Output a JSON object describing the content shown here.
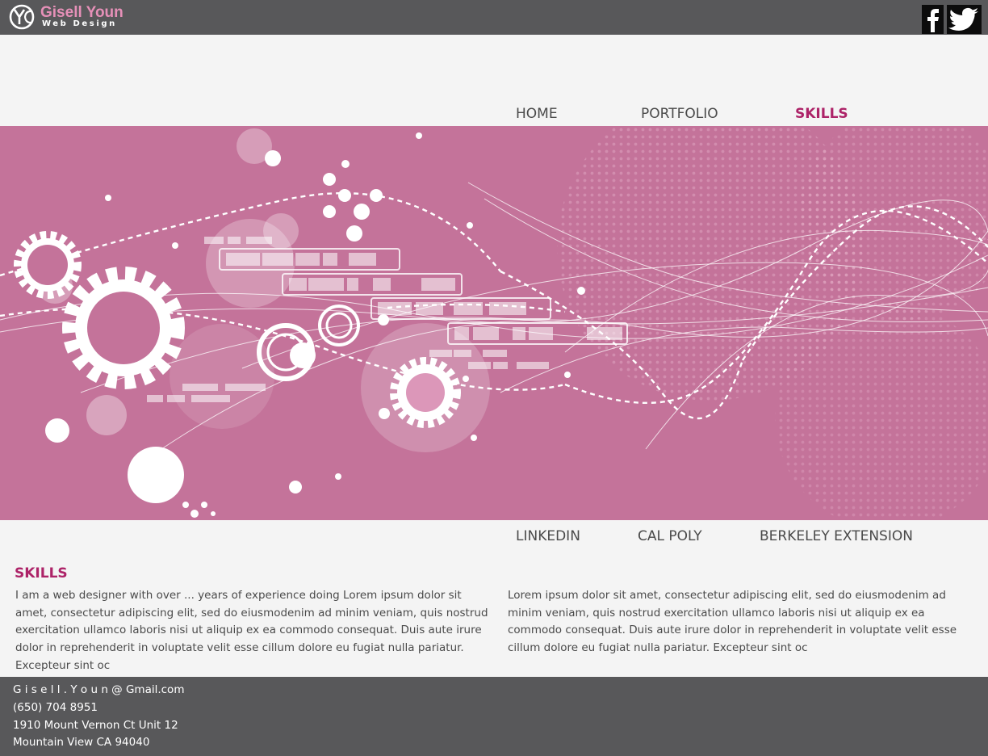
{
  "header": {
    "logo_name": "Gisell Youn",
    "logo_sub": "Web Design",
    "social": [
      {
        "name": "facebook",
        "icon": "facebook-icon"
      },
      {
        "name": "twitter",
        "icon": "twitter-icon"
      }
    ]
  },
  "nav_top": [
    {
      "label": "HOME",
      "active": false
    },
    {
      "label": "PORTFOLIO",
      "active": false
    },
    {
      "label": "SKILLS",
      "active": true
    }
  ],
  "nav_bottom": [
    {
      "label": "LINKEDIN"
    },
    {
      "label": "CAL POLY"
    },
    {
      "label": "BERKELEY EXTENSION"
    }
  ],
  "content": {
    "title": "SKILLS",
    "col1": "I am a web designer with over ... years of experience  doing Lorem ipsum dolor sit amet, consectetur adipiscing elit, sed do eiusmodenim ad minim veniam, quis nostrud exercitation ullamco laboris nisi ut aliquip ex ea commodo consequat. Duis aute irure dolor in reprehenderit in voluptate velit esse cillum dolore eu fugiat nulla pariatur. Excepteur sint oc",
    "col2": "Lorem ipsum dolor sit amet, consectetur adipiscing elit, sed do eiusmodenim ad minim veniam, quis nostrud exercitation ullamco laboris nisi ut aliquip ex ea commodo consequat. Duis aute irure dolor in reprehenderit in voluptate velit esse cillum dolore eu fugiat nulla pariatur. Excepteur sint oc"
  },
  "footer": {
    "email": "G i s e l l . Y o u n @ Gmail.com",
    "phone": "(650) 704 8951",
    "address1": "1910 Mount Vernon Ct Unit 12",
    "address2": "Mountain View CA 94040"
  },
  "colors": {
    "header_bg": "#58585a",
    "accent": "#ad2368",
    "logo_pink": "#e690b8",
    "banner_bg": "#c4739a",
    "page_bg": "#f4f4f4"
  }
}
